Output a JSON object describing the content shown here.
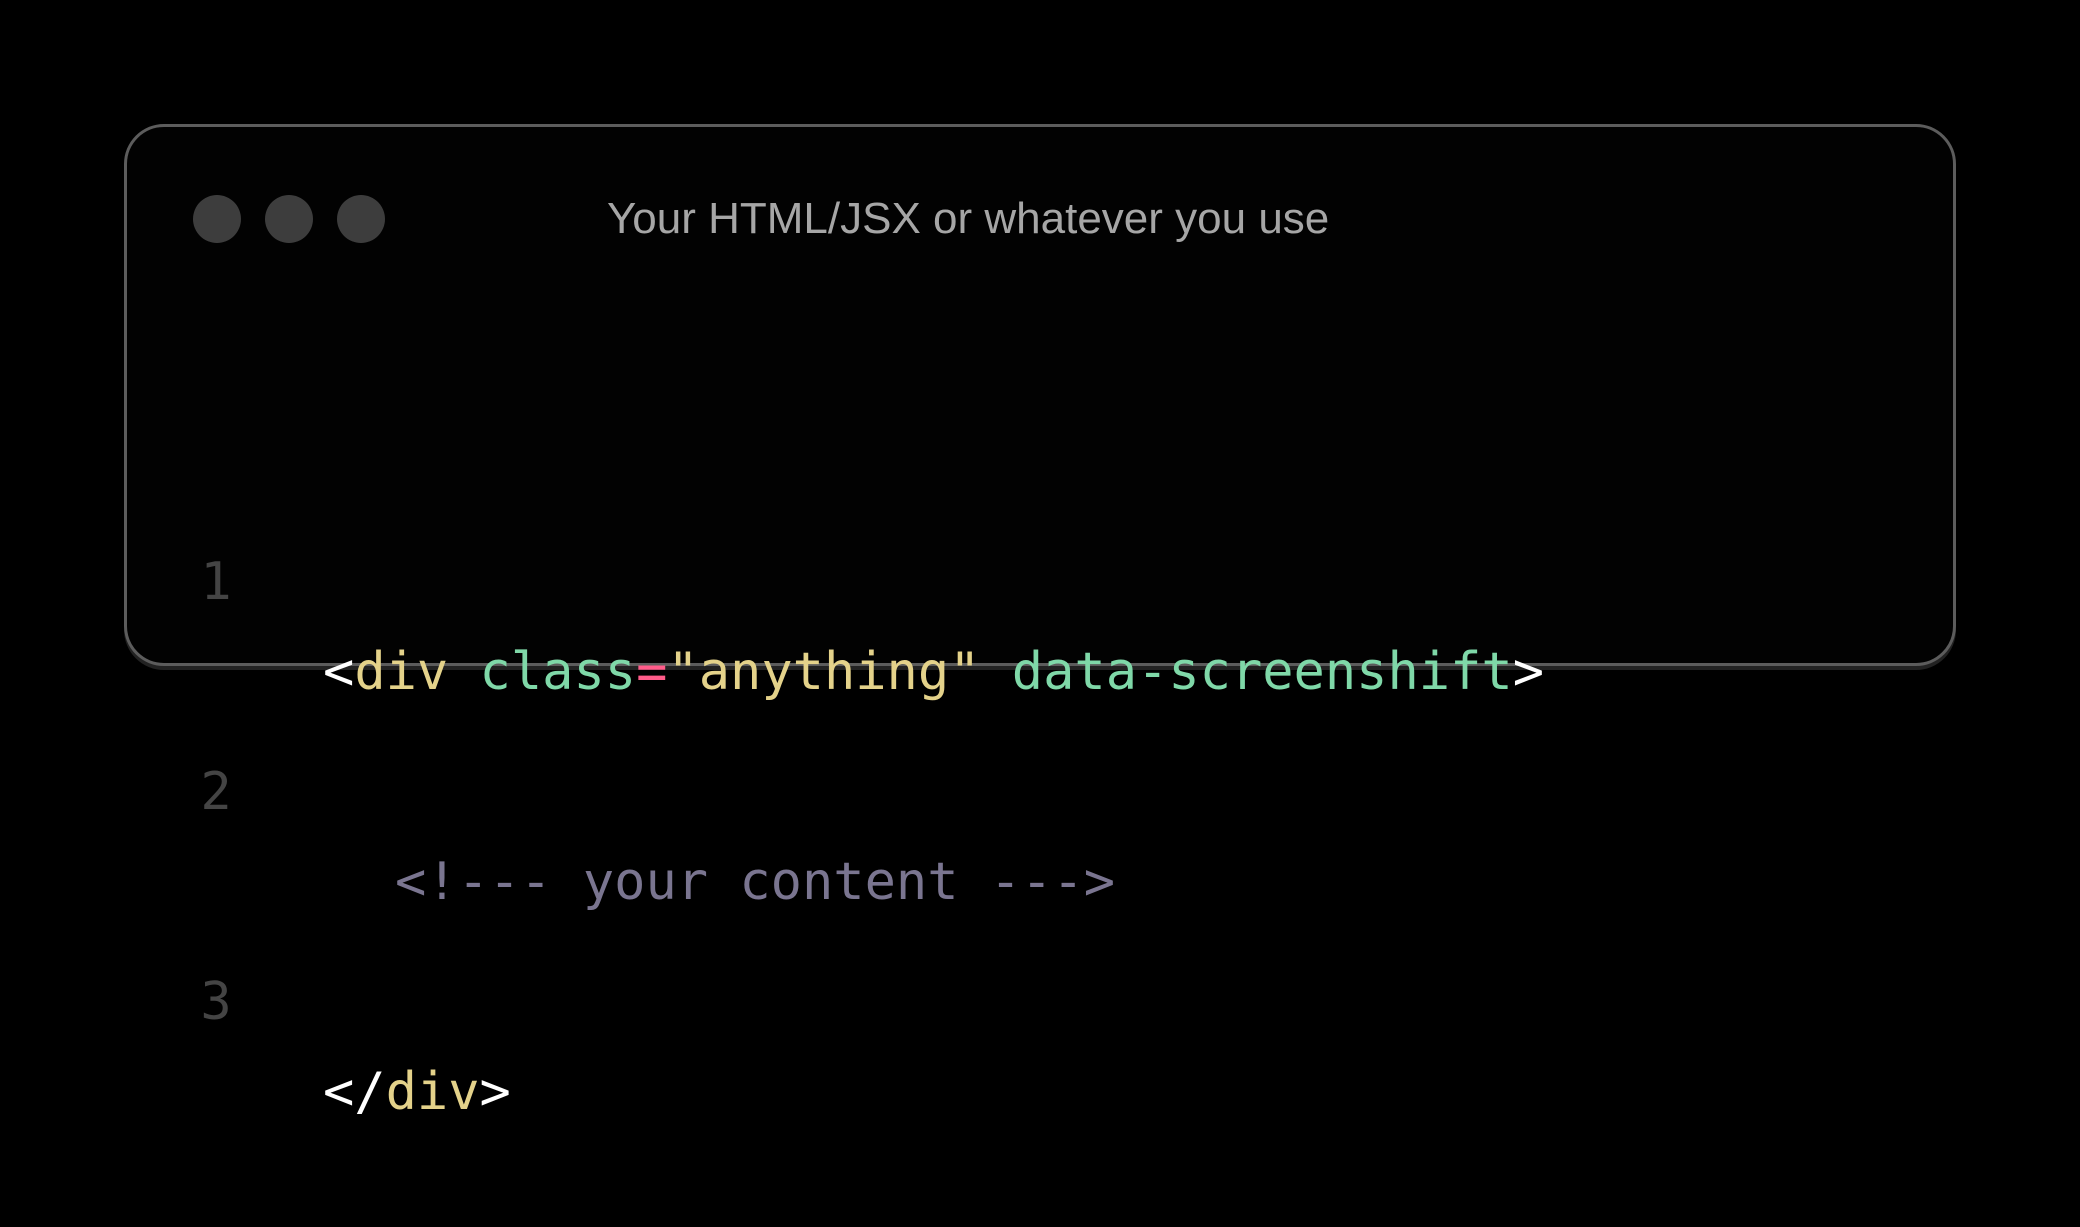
{
  "window": {
    "title": "Your HTML/JSX or whatever you use",
    "controls": [
      "close-dot",
      "minimize-dot",
      "maximize-dot"
    ]
  },
  "code": {
    "lines": [
      {
        "number": "1",
        "tokens": {
          "open_bracket": "<",
          "tag": "div",
          "attr": "class",
          "eq": "=",
          "str": "\"anything\"",
          "attr2": "data-screenshift",
          "close_bracket": ">"
        }
      },
      {
        "number": "2",
        "tokens": {
          "comment": "<!--- your content --->"
        }
      },
      {
        "number": "3",
        "tokens": {
          "open_bracket": "</",
          "tag": "div",
          "close_bracket": ">"
        }
      }
    ]
  },
  "colors": {
    "background": "#000000",
    "window_border": "#5c5c5c",
    "title_text": "#a6a6a6",
    "line_number": "#444444",
    "punctuation": "#ffffff",
    "tag": "#e4d28a",
    "attribute": "#7fd8a8",
    "equals": "#ff5c8a",
    "string": "#e4d28a",
    "comment": "#7a7590"
  }
}
